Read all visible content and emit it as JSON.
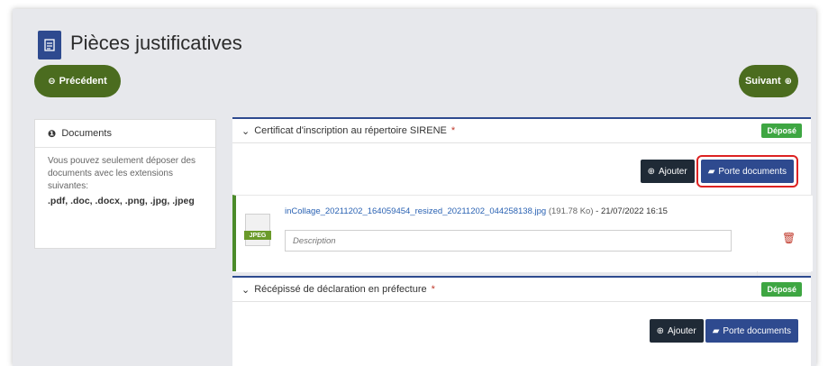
{
  "header": {
    "title": "Pièces justificatives"
  },
  "nav": {
    "prev_label": "Précédent",
    "next_label": "Suivant"
  },
  "info_panel": {
    "heading": "Documents",
    "text": "Vous pouvez seulement déposer des documents avec les extensions suivantes:",
    "extensions": ".pdf, .doc, .docx, .png, .jpg, .jpeg"
  },
  "sections": [
    {
      "title": "Certificat d'inscription au répertoire SIRENE",
      "required_mark": "*",
      "status": "Déposé",
      "add_label": "Ajouter",
      "portfolio_label": "Porte documents",
      "file": {
        "name": "inCollage_20211202_164059454_resized_20211202_044258138.jpg",
        "size": "(191.78 Ko)",
        "date": "- 21/07/2022 16:15",
        "type_tag": "JPEG",
        "description_placeholder": "Description"
      }
    },
    {
      "title": "Récépissé de déclaration en préfecture",
      "required_mark": "*",
      "status": "Déposé",
      "add_label": "Ajouter",
      "portfolio_label": "Porte documents"
    }
  ],
  "colors": {
    "primary_blue": "#2e4a8f",
    "nav_green": "#4b6c1f",
    "badge_green": "#3ea642",
    "highlight_red": "#d22222",
    "file_link": "#2a62b3"
  },
  "icons": {
    "title_icon": "document-icon",
    "prev_icon": "circle-arrow-left-icon",
    "next_icon": "circle-arrow-right-icon",
    "info_icon": "info-circle-icon",
    "section_icon": "chevron-circle-down-icon",
    "add_icon": "plus-circle-icon",
    "portfolio_icon": "briefcase-icon",
    "delete_icon": "trash-icon"
  }
}
